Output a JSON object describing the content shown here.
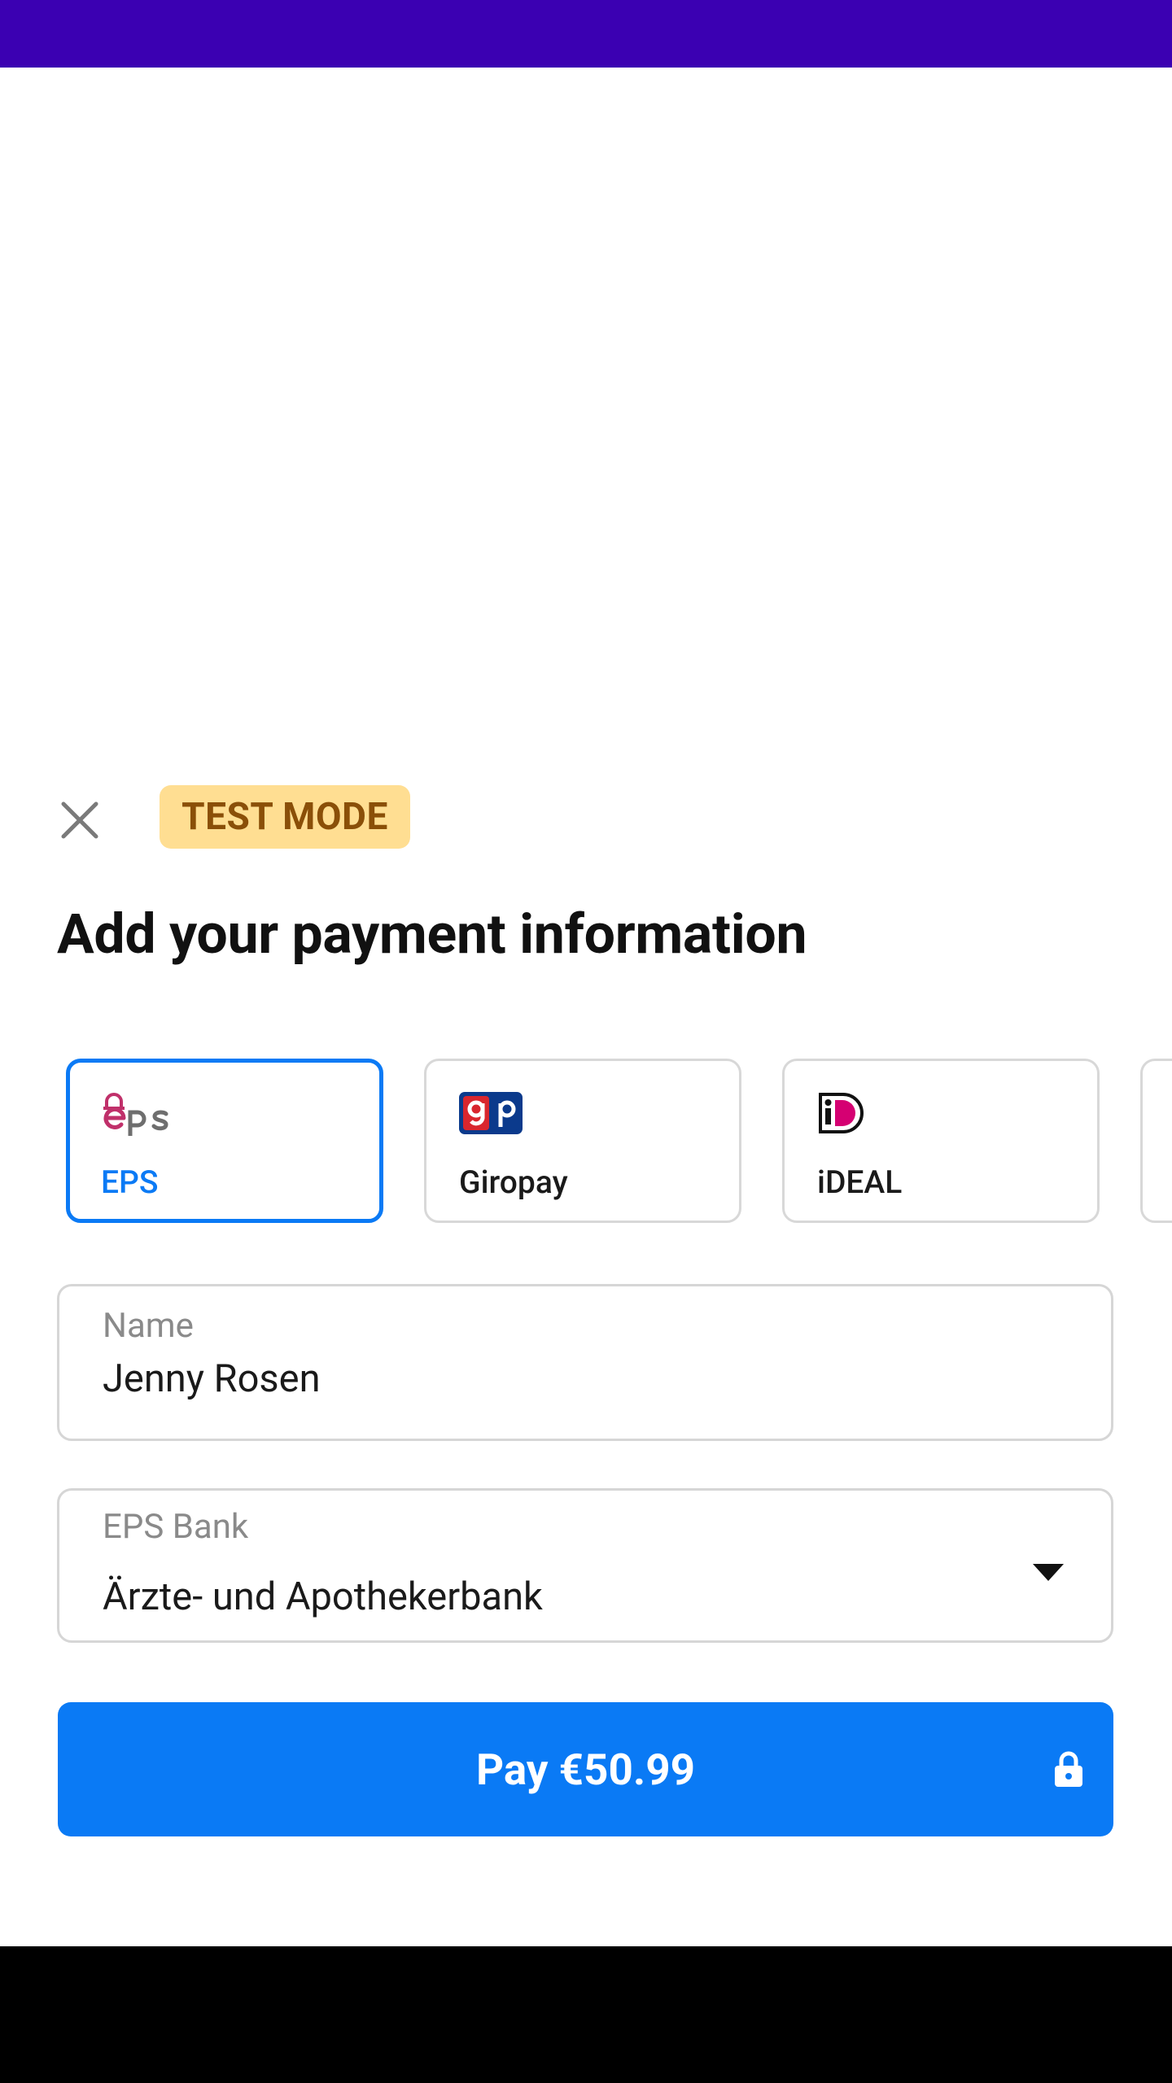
{
  "header": {
    "test_mode_badge": "TEST MODE",
    "close_icon": "close-icon"
  },
  "title": "Add your payment information",
  "payment_methods": [
    {
      "label": "EPS",
      "icon": "eps-logo-icon",
      "selected": true
    },
    {
      "label": "Giropay",
      "icon": "giropay-logo-icon",
      "selected": false
    },
    {
      "label": "iDEAL",
      "icon": "ideal-logo-icon",
      "selected": false
    }
  ],
  "name_field": {
    "label": "Name",
    "value": "Jenny Rosen"
  },
  "bank_field": {
    "label": "EPS Bank",
    "value": "Ärzte- und Apothekerbank",
    "icon": "chevron-down-icon"
  },
  "pay_button": {
    "label": "Pay €50.99",
    "icon": "lock-icon"
  },
  "colors": {
    "status_bar": "#3b00b2",
    "accent": "#0a7af5",
    "badge_bg": "#ffde92",
    "badge_text": "#8a4f08",
    "nav_bar": "#000000"
  }
}
